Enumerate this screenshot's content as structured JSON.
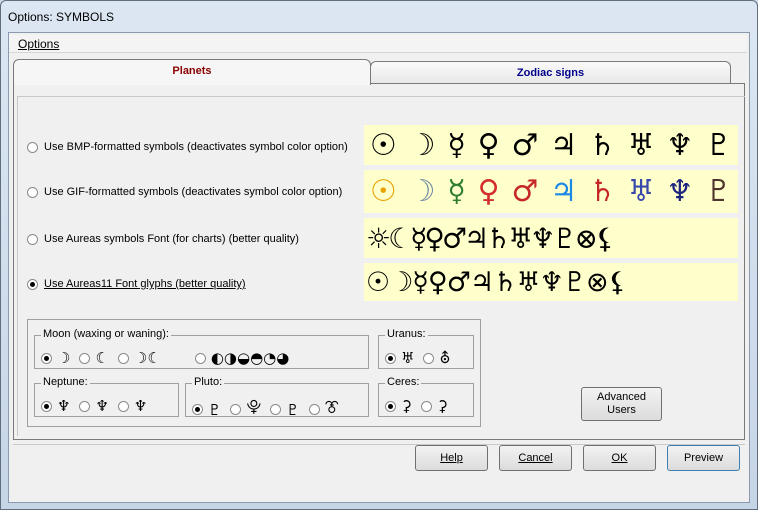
{
  "window": {
    "title": "Options: SYMBOLS"
  },
  "menu": {
    "options_label": "Options"
  },
  "tabs": [
    {
      "label": "Planets",
      "active": true
    },
    {
      "label": "Zodiac signs",
      "active": false
    }
  ],
  "symbol_options": [
    {
      "label": "Use BMP-formatted symbols (deactivates symbol color option)",
      "selected": false,
      "preview": [
        "☉",
        "☽",
        "☿",
        "♀",
        "♂",
        "♃",
        "♄",
        "♅",
        "♆",
        "♇"
      ]
    },
    {
      "label": "Use GIF-formatted symbols (deactivates symbol color option)",
      "selected": false,
      "preview": [
        "☉",
        "☽",
        "☿",
        "♀",
        "♂",
        "♃",
        "♄",
        "♅",
        "♆",
        "♇"
      ],
      "preview_colors": [
        "#e6a300",
        "#6e8aa0",
        "#2e7d32",
        "#d32f2f",
        "#c62828",
        "#1e88e5",
        "#c62828",
        "#3949ab",
        "#1a237e",
        "#4e342e"
      ]
    },
    {
      "label": "Use Aureas symbols Font (for charts) (better quality)",
      "selected": false,
      "preview": "☼☾☿♀♂♃♄♅♆♇⊗⚸"
    },
    {
      "label": "Use Aureas11 Font glyphs (better quality)",
      "selected": true,
      "preview": "☉☽☿♀♂♃♄♅♆♇⊗⚸"
    }
  ],
  "groups": {
    "moon": {
      "label": "Moon (waxing or waning):",
      "options": [
        {
          "sym": "☽",
          "selected": true
        },
        {
          "sym": "☾",
          "selected": false
        },
        {
          "sym": "☽☾",
          "selected": false
        },
        {
          "sym": "◐◑◒◓◔◕",
          "selected": false
        }
      ]
    },
    "uranus": {
      "label": "Uranus:",
      "options": [
        {
          "sym": "♅",
          "selected": true
        },
        {
          "sym": "⛢",
          "selected": false
        }
      ]
    },
    "neptune": {
      "label": "Neptune:",
      "options": [
        {
          "sym": "♆",
          "selected": true
        },
        {
          "sym": "♆",
          "selected": false
        },
        {
          "sym": "♆",
          "selected": false
        }
      ]
    },
    "pluto": {
      "label": "Pluto:",
      "options": [
        {
          "sym": "♇",
          "selected": true
        },
        {
          "sym": "⯓",
          "selected": false
        },
        {
          "sym": "♇",
          "selected": false
        },
        {
          "sym": "⯔",
          "selected": false
        }
      ]
    },
    "ceres": {
      "label": "Ceres:",
      "options": [
        {
          "sym": "⚳",
          "selected": true
        },
        {
          "sym": "⚳",
          "selected": false
        }
      ]
    }
  },
  "buttons": {
    "advanced_users": "Advanced Users",
    "help": "Help",
    "cancel": "Cancel",
    "ok": "OK",
    "preview": "Preview"
  }
}
